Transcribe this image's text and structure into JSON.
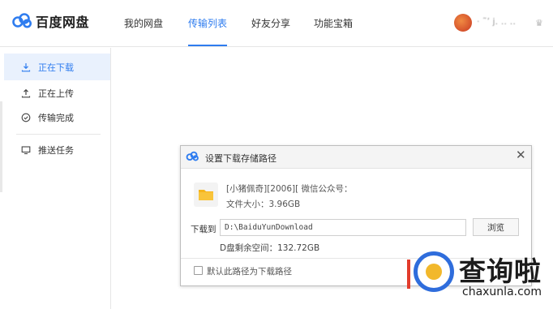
{
  "app": {
    "title": "百度网盘"
  },
  "nav": {
    "items": [
      {
        "label": "我的网盘",
        "active": false
      },
      {
        "label": "传输列表",
        "active": true
      },
      {
        "label": "好友分享",
        "active": false
      },
      {
        "label": "功能宝箱",
        "active": false
      }
    ]
  },
  "user": {
    "name": "· ˜ʼ j․ ․․ ‥"
  },
  "sidebar": {
    "items": [
      {
        "label": "正在下载",
        "icon": "download-icon",
        "active": true
      },
      {
        "label": "正在上传",
        "icon": "upload-icon",
        "active": false
      },
      {
        "label": "传输完成",
        "icon": "check-circle-icon",
        "active": false
      },
      {
        "label": "推送任务",
        "icon": "monitor-icon",
        "active": false
      }
    ]
  },
  "dialog": {
    "title": "设置下载存储路径",
    "file_name": "[小猪佩奇][2006][ 微信公众号：",
    "file_size": "文件大小：3.96GB",
    "download_to_label": "下载到",
    "path_value": "D:\\BaiduYunDownload",
    "browse_label": "浏览",
    "free_space": "D盘剩余空间：132.72GB",
    "default_path_label": "默认此路径为下载路径",
    "default_path_checked": false
  },
  "watermark": {
    "cn": "查询啦",
    "en": "chaxunla.com"
  },
  "colors": {
    "accent": "#2e7cef",
    "folder": "#f6b51c",
    "active_bg": "#e9f1fd"
  }
}
